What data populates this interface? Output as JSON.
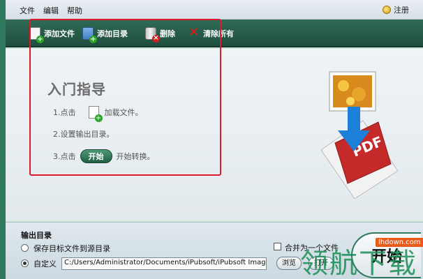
{
  "menu": {
    "file": "文件",
    "edit": "编辑",
    "help": "帮助",
    "register": "注册"
  },
  "toolbar": {
    "add_file": "添加文件",
    "add_folder": "添加目录",
    "delete": "删除",
    "clear_all": "清除所有"
  },
  "guide": {
    "title": "入门指导",
    "step1_prefix": "1.点击",
    "step1_suffix": "加载文件。",
    "step2": "2.设置输出目录。",
    "step3_prefix": "3.点击",
    "step3_button": "开始",
    "step3_suffix": "开始转换。"
  },
  "output": {
    "label": "输出目录",
    "option_source": "保存目标文件到源目录",
    "option_custom": "自定义",
    "path": "C:/Users/Administrator/Documents/iPubsoft/iPubsoft Image to",
    "browse": "浏览",
    "open": "打开",
    "merge": "合并为一个文件"
  },
  "start_button": "开始",
  "watermark": {
    "text": "领航下载",
    "url": "lhdown.com"
  },
  "colors": {
    "toolbar": "#2f6a55",
    "highlight_box": "#e0182e",
    "pdf_red": "#c42a2a",
    "arrow": "#1c7fd8"
  }
}
